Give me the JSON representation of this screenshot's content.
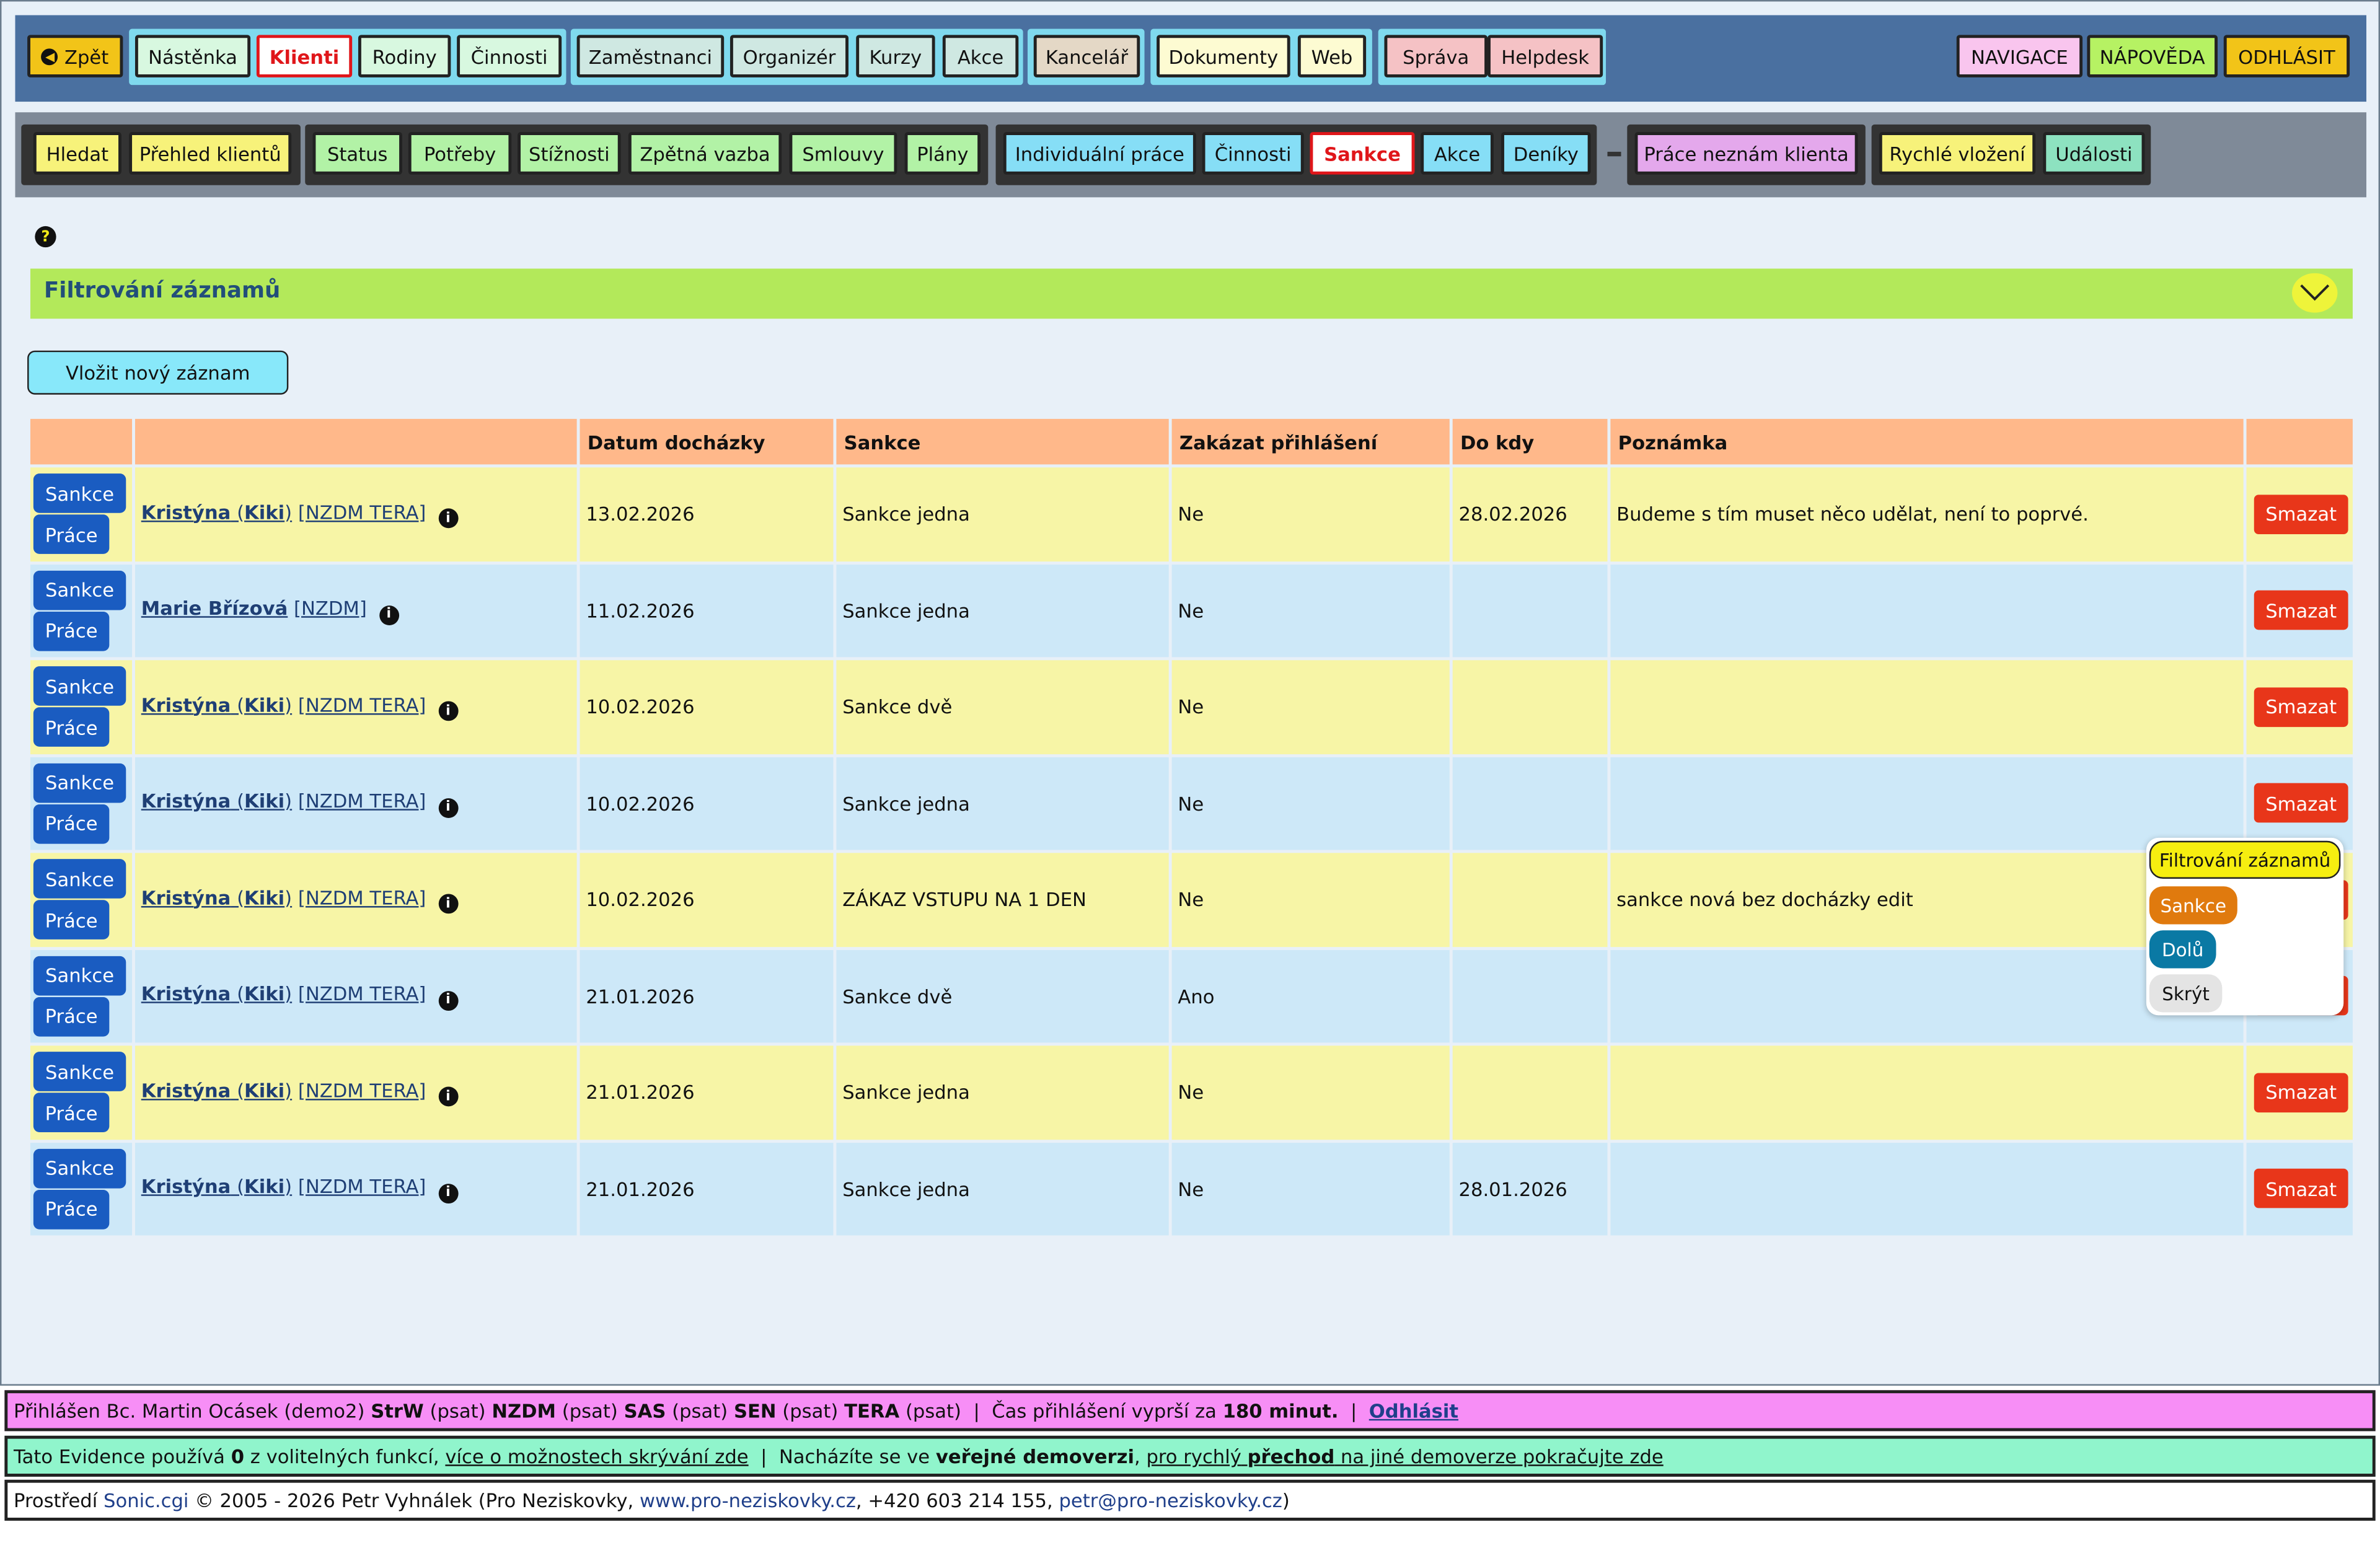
{
  "topnav": {
    "back": "Zpět",
    "items": [
      "Nástěnka",
      "Klienti",
      "Rodiny",
      "Činnosti",
      "Zaměstnanci",
      "Organizér",
      "Kurzy",
      "Akce",
      "Kancelář",
      "Dokumenty",
      "Web",
      "Správa",
      "Helpdesk"
    ],
    "right": [
      "NAVIGACE",
      "NÁPOVĚDA",
      "ODHLÁSIT"
    ]
  },
  "subnav": {
    "items": [
      "Hledat",
      "Přehled klientů",
      "Status",
      "Potřeby",
      "Stížnosti",
      "Zpětná vazba",
      "Smlouvy",
      "Plány",
      "Individuální práce",
      "Činnosti",
      "Sankce",
      "Akce",
      "Deníky",
      "Práce neznám klienta",
      "Rychlé vložení",
      "Události"
    ]
  },
  "help_icon": "question-icon",
  "filter": {
    "title": "Filtrování záznamů"
  },
  "new_record": "Vložit nový záznam",
  "table": {
    "headers": [
      "",
      "",
      "Datum docházky",
      "Sankce",
      "Zakázat přihlášení",
      "Do kdy",
      "Poznámka",
      ""
    ],
    "row_buttons": {
      "sankce": "Sankce",
      "prace": "Práce",
      "delete": "Smazat"
    },
    "rows": [
      {
        "first": "Kristýna",
        "nick": "Kiki",
        "last": "",
        "tags": "[NZDM TERA]",
        "date": "13.02.2026",
        "sanction": "Sankce jedna",
        "ban": "Ne",
        "until": "28.02.2026",
        "note": "Budeme s tím muset něco udělat, není to poprvé."
      },
      {
        "first": "Marie Břízová",
        "nick": "",
        "last": "",
        "tags": "[NZDM]",
        "date": "11.02.2026",
        "sanction": "Sankce jedna",
        "ban": "Ne",
        "until": "",
        "note": ""
      },
      {
        "first": "Kristýna",
        "nick": "Kiki",
        "last": "",
        "tags": "[NZDM TERA]",
        "date": "10.02.2026",
        "sanction": "Sankce dvě",
        "ban": "Ne",
        "until": "",
        "note": ""
      },
      {
        "first": "Kristýna",
        "nick": "Kiki",
        "last": "",
        "tags": "[NZDM TERA]",
        "date": "10.02.2026",
        "sanction": "Sankce jedna",
        "ban": "Ne",
        "until": "",
        "note": ""
      },
      {
        "first": "Kristýna",
        "nick": "Kiki",
        "last": "",
        "tags": "[NZDM TERA]",
        "date": "10.02.2026",
        "sanction": "ZÁKAZ VSTUPU NA 1 DEN",
        "ban": "Ne",
        "until": "",
        "note": "sankce nová bez docházky edit"
      },
      {
        "first": "Kristýna",
        "nick": "Kiki",
        "last": "",
        "tags": "[NZDM TERA]",
        "date": "21.01.2026",
        "sanction": "Sankce dvě",
        "ban": "Ano",
        "until": "",
        "note": ""
      },
      {
        "first": "Kristýna",
        "nick": "Kiki",
        "last": "",
        "tags": "[NZDM TERA]",
        "date": "21.01.2026",
        "sanction": "Sankce jedna",
        "ban": "Ne",
        "until": "",
        "note": ""
      },
      {
        "first": "Kristýna",
        "nick": "Kiki",
        "last": "",
        "tags": "[NZDM TERA]",
        "date": "21.01.2026",
        "sanction": "Sankce jedna",
        "ban": "Ne",
        "until": "28.01.2026",
        "note": ""
      }
    ]
  },
  "context_menu": {
    "items": [
      "Filtrování záznamů",
      "Sankce",
      "Dolů",
      "Skrýt"
    ]
  },
  "footer": {
    "login": {
      "prefix": "Přihlášen Bc. Martin Ocásek (demo2)",
      "roles": [
        [
          "StrW",
          "(psat)"
        ],
        [
          "NZDM",
          "(psat)"
        ],
        [
          "SAS",
          "(psat)"
        ],
        [
          "SEN",
          "(psat)"
        ],
        [
          "TERA",
          "(psat)"
        ]
      ],
      "expires_prefix": "Čas přihlášení vyprší za",
      "expires_value": "180 minut.",
      "logout": "Odhlásit"
    },
    "info": {
      "t1": "Tato Evidence používá",
      "count": "0",
      "t2": "z volitelných funkcí,",
      "link1": "více o možnostech skrývání zde",
      "t3": "Nacházíte se ve",
      "bold1": "veřejné demoverzi",
      "t4": ",",
      "link2a": "pro rychlý",
      "link2b": "přechod",
      "link2c": "na jiné demoverze pokračujte zde"
    },
    "copy": {
      "t1": "Prostředí",
      "sonic": "Sonic.cgi",
      "t2": "© 2005 - 2026 Petr Vyhnálek (Pro Neziskovky,",
      "web": "www.pro-neziskovky.cz",
      "t3": ", +420 603 214 155,",
      "mail": "petr@pro-neziskovky.cz",
      "t4": ")"
    }
  }
}
